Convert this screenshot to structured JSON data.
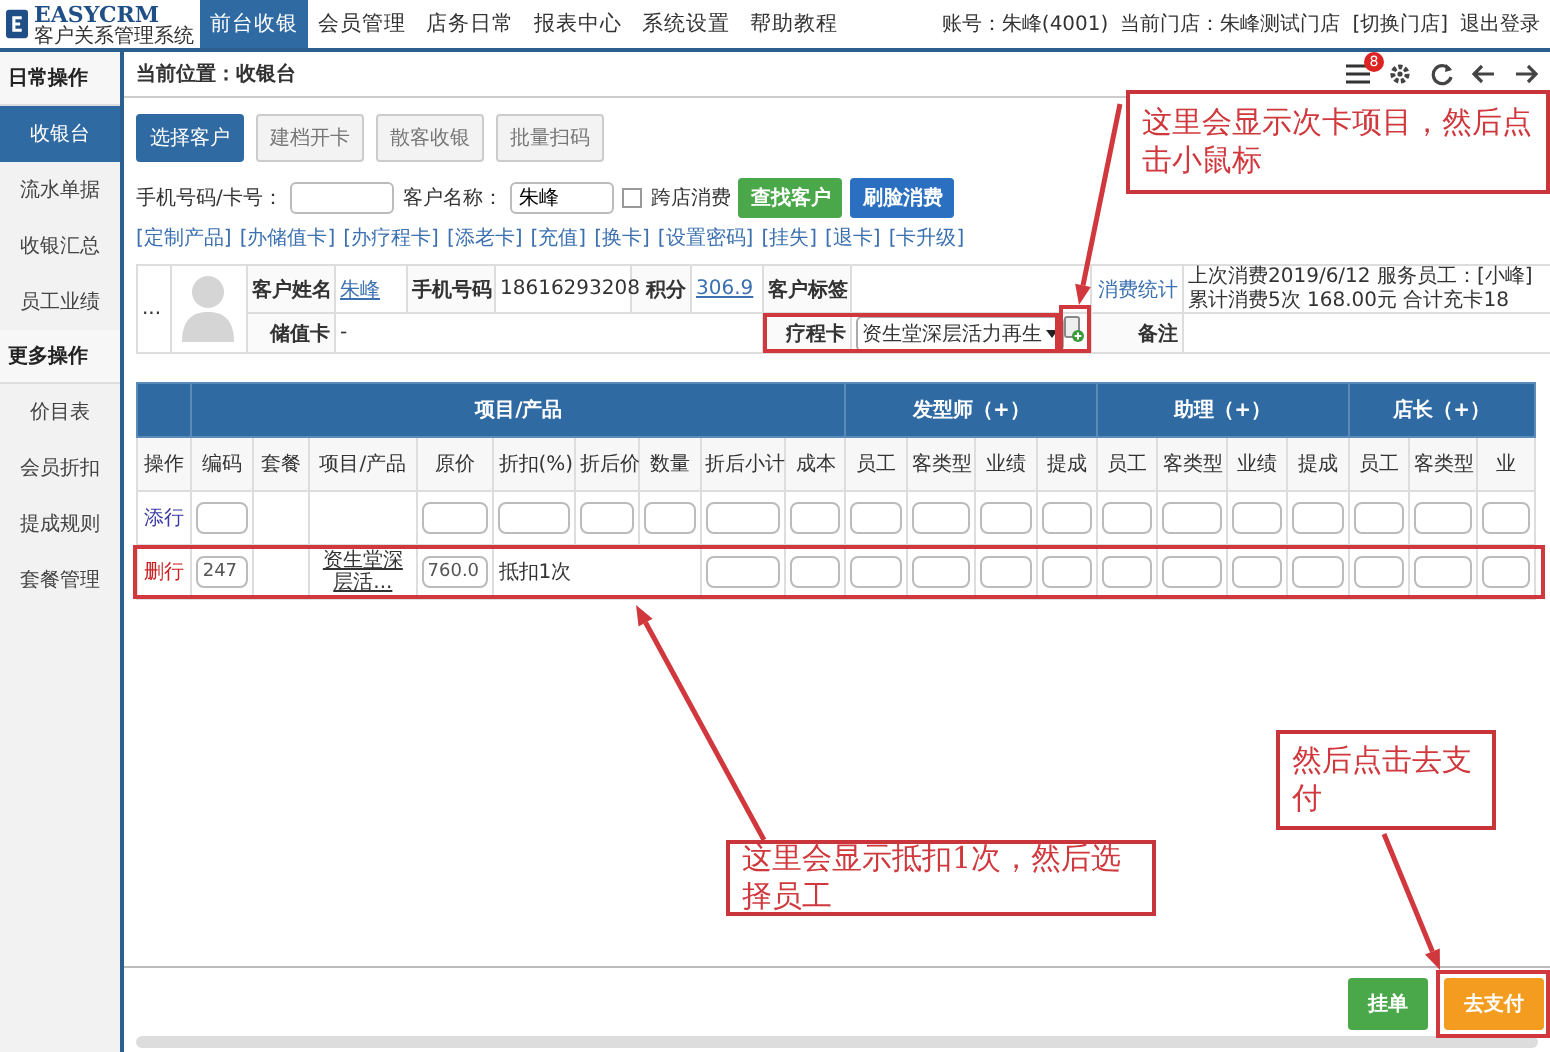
{
  "topbar": {
    "logo_title": "EASYCRM",
    "logo_subtitle": "客户关系管理系统",
    "nav": [
      {
        "label": "前台收银",
        "selected": true
      },
      {
        "label": "会员管理",
        "selected": false
      },
      {
        "label": "店务日常",
        "selected": false
      },
      {
        "label": "报表中心",
        "selected": false
      },
      {
        "label": "系统设置",
        "selected": false
      },
      {
        "label": "帮助教程",
        "selected": false
      }
    ],
    "account": "账号：朱峰(4001)",
    "store": "当前门店：朱峰测试门店",
    "switch_store": "[切换门店]",
    "logout": "退出登录"
  },
  "sidebar": {
    "sections": [
      {
        "title": "日常操作",
        "items": [
          {
            "label": "收银台",
            "selected": true
          },
          {
            "label": "流水单据",
            "selected": false
          },
          {
            "label": "收银汇总",
            "selected": false
          },
          {
            "label": "员工业绩",
            "selected": false
          }
        ]
      },
      {
        "title": "更多操作",
        "items": [
          {
            "label": "价目表",
            "selected": false
          },
          {
            "label": "会员折扣",
            "selected": false
          },
          {
            "label": "提成规则",
            "selected": false
          },
          {
            "label": "套餐管理",
            "selected": false
          }
        ]
      }
    ]
  },
  "breadcrumb": "当前位置：收银台",
  "notification_count": "8",
  "mode_buttons": [
    {
      "label": "选择客户",
      "selected": true
    },
    {
      "label": "建档开卡",
      "selected": false
    },
    {
      "label": "散客收银",
      "selected": false
    },
    {
      "label": "批量扫码",
      "selected": false
    }
  ],
  "search": {
    "phone_label": "手机号码/卡号：",
    "name_label": "客户名称：",
    "name_value": "朱峰",
    "cross_store": {
      "label": "跨店消费",
      "checked": false
    },
    "find_button": "查找客户",
    "face_button": "刷脸消费"
  },
  "action_links": [
    "[定制产品]",
    "[办储值卡]",
    "[办疗程卡]",
    "[添老卡]",
    "[充值]",
    "[换卡]",
    "[设置密码]",
    "[挂失]",
    "[退卡]",
    "[卡升级]"
  ],
  "customer": {
    "more": "...",
    "name_label": "客户姓名",
    "name": "朱峰",
    "phone_label": "手机号码",
    "phone": "18616293208",
    "points_label": "积分",
    "points": "306.9",
    "tag_label": "客户标签",
    "stats_link": "消费统计",
    "stats": "上次消费2019/6/12 服务员工：[小峰] 累计消费5次 168.00元 合计充卡18",
    "stored_card_label": "储值卡",
    "stored_card": "-",
    "course_card_label": "疗程卡",
    "course_card": "资生堂深层活力再生",
    "remark_label": "备注"
  },
  "items_table": {
    "column_groups": [
      {
        "columns": [
          "操作"
        ]
      },
      {
        "label": "项目/产品",
        "columns": [
          "编码",
          "套餐",
          "项目/产品",
          "原价",
          "折扣(%)",
          "折后价",
          "数量",
          "折后小计",
          "成本"
        ]
      },
      {
        "label": "发型师（+）",
        "columns": [
          "员工",
          "客类型",
          "业绩",
          "提成"
        ]
      },
      {
        "label": "助理（+）",
        "columns": [
          "员工",
          "客类型",
          "业绩",
          "提成"
        ]
      },
      {
        "label": "店长（+）",
        "columns": [
          "员工",
          "客类型",
          "业"
        ]
      }
    ],
    "rows": [
      {
        "kind": "add",
        "action": "添行",
        "cells": [
          {
            "kind": "input"
          },
          {
            "kind": "empty"
          },
          {
            "kind": "empty"
          },
          {
            "kind": "input"
          },
          {
            "kind": "input"
          },
          {
            "kind": "input"
          },
          {
            "kind": "input"
          },
          {
            "kind": "input"
          },
          {
            "kind": "input"
          },
          {
            "kind": "input"
          },
          {
            "kind": "input"
          },
          {
            "kind": "input"
          },
          {
            "kind": "input"
          },
          {
            "kind": "input"
          },
          {
            "kind": "input"
          },
          {
            "kind": "input"
          },
          {
            "kind": "input"
          },
          {
            "kind": "input"
          },
          {
            "kind": "input"
          },
          {
            "kind": "input"
          }
        ]
      },
      {
        "kind": "delete",
        "action": "删行",
        "cells": [
          {
            "kind": "input",
            "value": "247"
          },
          {
            "kind": "empty"
          },
          {
            "kind": "text",
            "text": "资生堂深层活..."
          },
          {
            "kind": "input",
            "value": "760.0"
          },
          {
            "kind": "note",
            "text": "抵扣1次"
          },
          {
            "kind": "input"
          },
          {
            "kind": "input"
          },
          {
            "kind": "input"
          },
          {
            "kind": "input"
          },
          {
            "kind": "input"
          },
          {
            "kind": "input"
          },
          {
            "kind": "input"
          },
          {
            "kind": "input"
          },
          {
            "kind": "input"
          },
          {
            "kind": "input"
          },
          {
            "kind": "input"
          },
          {
            "kind": "input"
          },
          {
            "kind": "input"
          }
        ]
      }
    ]
  },
  "footer_buttons": [
    {
      "kind": "hold",
      "label": "挂单"
    },
    {
      "kind": "pay",
      "label": "去支付"
    }
  ],
  "annotations": [
    {
      "text": "这里会显示次卡项目，然后点击小鼠标"
    },
    {
      "text": "这里会显示抵扣1次，然后选择员工"
    },
    {
      "text": "然后点击去支付"
    }
  ]
}
